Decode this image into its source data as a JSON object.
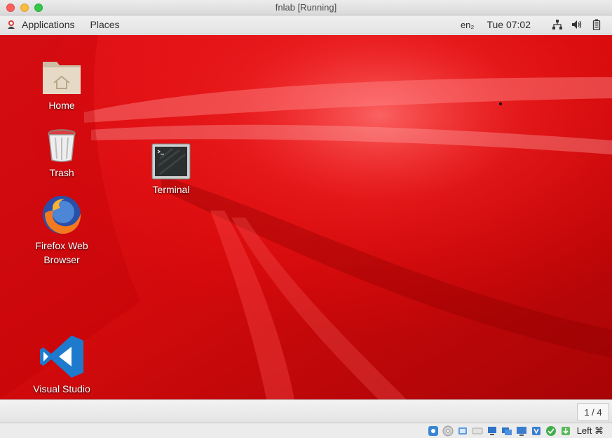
{
  "window": {
    "title": "fnlab [Running]"
  },
  "panel": {
    "applications_label": "Applications",
    "places_label": "Places",
    "keyboard_layout": "en₂",
    "clock": "Tue 07:02"
  },
  "desktop": {
    "icons": [
      {
        "label": "Home",
        "icon": "home-folder-icon"
      },
      {
        "label": "Trash",
        "icon": "trash-icon"
      },
      {
        "label": "Firefox Web Browser",
        "icon": "firefox-icon"
      },
      {
        "label": "Terminal",
        "icon": "terminal-icon"
      },
      {
        "label": "Visual Studio Code",
        "icon": "vscode-icon"
      }
    ]
  },
  "workspace": {
    "indicator": "1 / 4"
  },
  "statusbar": {
    "host_key": "Left ⌘"
  },
  "colors": {
    "desktop_bg": "#d40c0e",
    "panel_bg": "#e8e8e8"
  }
}
